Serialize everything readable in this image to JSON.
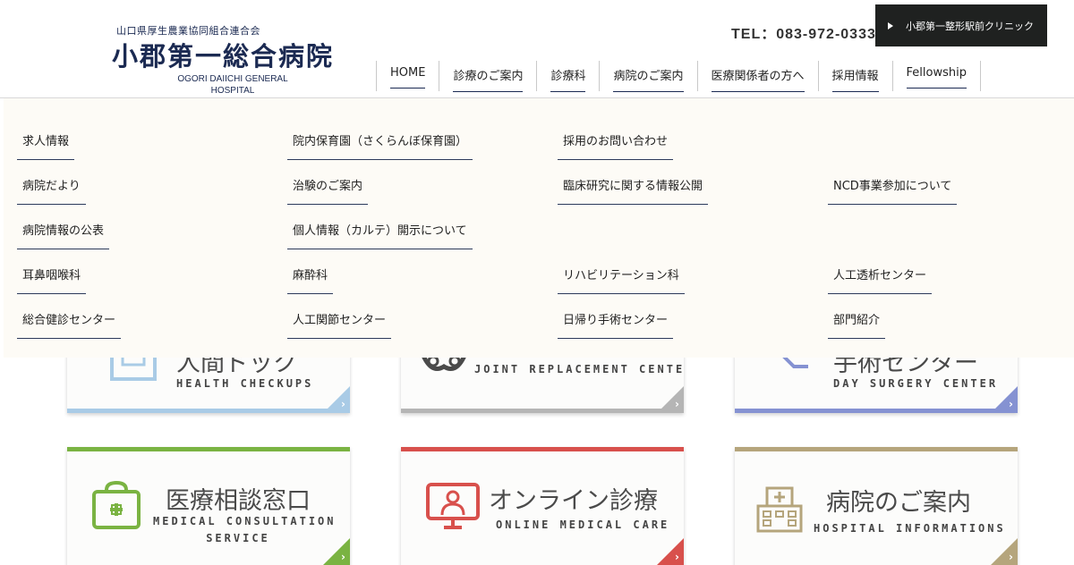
{
  "header": {
    "org": "山口県厚生農業協同組合連合会",
    "name": "小郡第一総合病院",
    "name_en_line1": "OGORI DAIICHI GENERAL",
    "name_en_line2": "HOSPITAL",
    "tel": "TEL：083-972-0333",
    "clinic_button": "小郡第一整形駅前クリニック"
  },
  "nav": [
    {
      "label": "HOME"
    },
    {
      "label": "診療のご案内"
    },
    {
      "label": "診療科"
    },
    {
      "label": "病院のご案内"
    },
    {
      "label": "医療関係者の方へ"
    },
    {
      "label": "採用情報"
    },
    {
      "label": "Fellowship"
    }
  ],
  "mega_menu": {
    "col1": [
      "求人情報",
      "病院だより",
      "病院情報の公表",
      "耳鼻咽喉科",
      "総合健診センター"
    ],
    "col2": [
      "院内保育園（さくらんぼ保育園）",
      "治験のご案内",
      "個人情報（カルテ）開示について",
      "麻酔科",
      "人工関節センター"
    ],
    "col3": [
      "採用のお問い合わせ",
      "臨床研究に関する情報公開",
      "リハビリテーション科",
      "日帰り手術センター"
    ],
    "col4": [
      "NCD事業参加について",
      "人工透析センター",
      "部門紹介"
    ]
  },
  "cards_top": [
    {
      "jp": "人間ドック",
      "en": "HEALTH CHECKUPS",
      "color": "#a9cbe6"
    },
    {
      "jp": "",
      "en": "JOINT REPLACEMENT CENTER",
      "color": "#b5b5b5"
    },
    {
      "jp": "手術センター",
      "en": "DAY SURGERY CENTER",
      "color": "#8592d2"
    }
  ],
  "cards_bottom": [
    {
      "jp": "医療相談窓口",
      "en1": "MEDICAL CONSULTATION",
      "en2": "SERVICE",
      "color": "#7ab342"
    },
    {
      "jp": "オンライン診療",
      "en1": "ONLINE MEDICAL CARE",
      "color": "#d8504c"
    },
    {
      "jp": "病院のご案内",
      "en1": "HOSPITAL INFORMATIONS",
      "color": "#b5a57c"
    }
  ],
  "icons": [
    "clipboard-icon",
    "joint-icon",
    "arrow-icon",
    "medical-kit-icon",
    "doctor-monitor-icon",
    "hospital-building-icon",
    "chevron-right-icon",
    "play-triangle-icon"
  ]
}
